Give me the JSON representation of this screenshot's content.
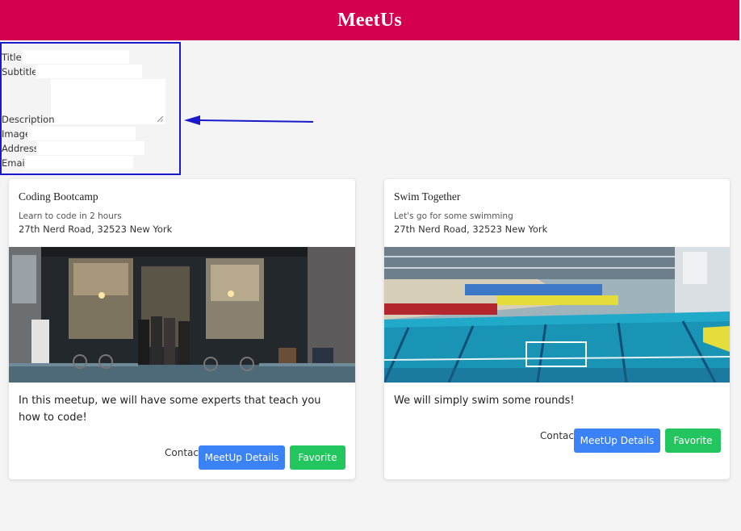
{
  "header": {
    "title": "MeetUs",
    "color": "#d4004f"
  },
  "form": {
    "title_label": "Title",
    "subtitle_label": "Subtitle",
    "description_label": "Description",
    "image_label": "Image",
    "address_label": "Address",
    "email_label": "Email"
  },
  "meetups": [
    {
      "title": "Coding Bootcamp",
      "subtitle": "Learn to code in 2 hours",
      "address": "27th Nerd Road, 32523 New York",
      "description": "In this meetup, we will have some experts that teach you how to code!",
      "contact_label": "Contact",
      "details_label": "MeetUp Details",
      "favorite_label": "Favorite"
    },
    {
      "title": "Swim Together",
      "subtitle": "Let's go for some swimming",
      "address": "27th Nerd Road, 32523 New York",
      "description": "We will simply swim some rounds!",
      "contact_label": "Contact",
      "details_label": "MeetUp Details",
      "favorite_label": "Favorite"
    }
  ],
  "colors": {
    "details_button": "#3b82f6",
    "favorite_button": "#22c55e",
    "form_border": "#1a1acc"
  }
}
